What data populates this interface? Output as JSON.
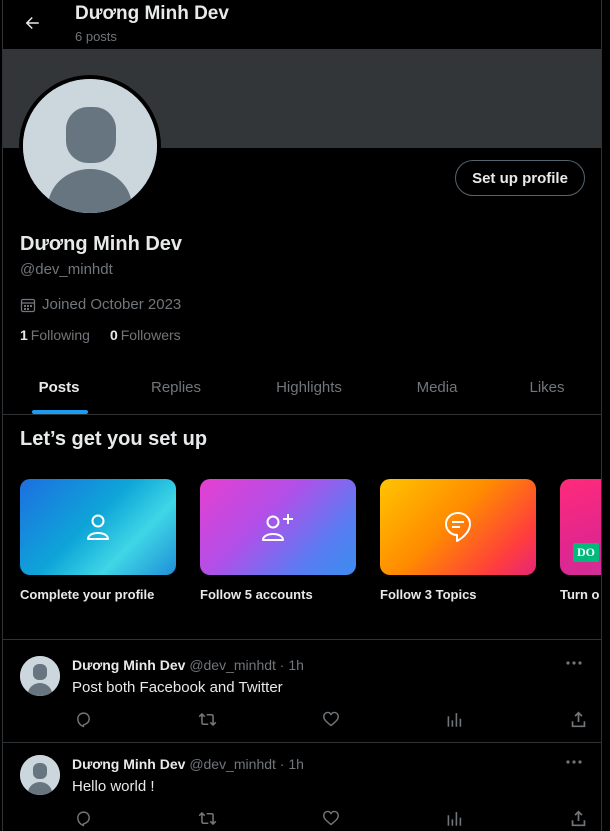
{
  "header": {
    "back_icon": "arrow-left-icon",
    "name": "Dương Minh Dev",
    "post_count": "6 posts"
  },
  "profile": {
    "name": "Dương Minh Dev",
    "handle": "@dev_minhdt",
    "joined": "Joined October 2023",
    "following_count": "1",
    "following_label": "Following",
    "followers_count": "0",
    "followers_label": "Followers",
    "setup_button": "Set up profile"
  },
  "tabs": [
    {
      "label": "Posts",
      "active": true
    },
    {
      "label": "Replies",
      "active": false
    },
    {
      "label": "Highlights",
      "active": false
    },
    {
      "label": "Media",
      "active": false
    },
    {
      "label": "Likes",
      "active": false
    }
  ],
  "setup": {
    "title": "Let’s get you set up",
    "cards": [
      {
        "label": "Complete your profile",
        "icon": "person-icon"
      },
      {
        "label": "Follow 5 accounts",
        "icon": "person-add-icon"
      },
      {
        "label": "Follow 3 Topics",
        "icon": "topic-bubble-icon"
      },
      {
        "label": "Turn o",
        "badge": "DO"
      }
    ]
  },
  "posts": [
    {
      "name": "Dương Minh Dev",
      "meta": "@dev_minhdt · 1h",
      "text": "Post both Facebook and Twitter"
    },
    {
      "name": "Dương Minh Dev",
      "meta": "@dev_minhdt · 1h",
      "text": "Hello world !"
    }
  ],
  "colors": {
    "accent": "#1d9bf0",
    "background": "#000000",
    "banner": "#333639",
    "muted_text": "#71767b"
  }
}
